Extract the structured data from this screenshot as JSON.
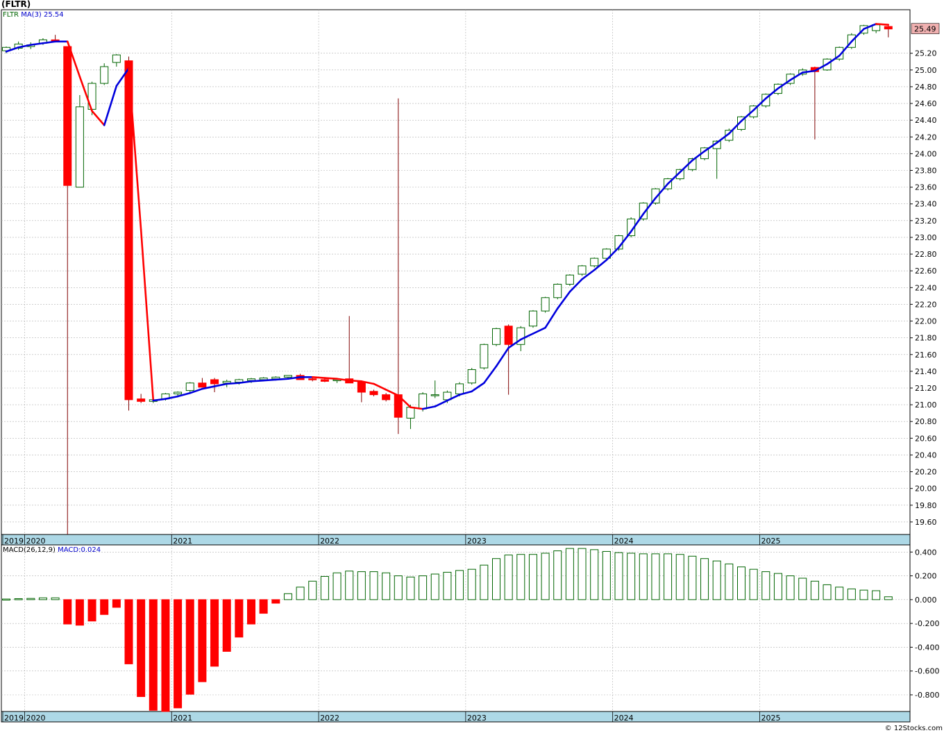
{
  "title": "(FLTR)",
  "legend": {
    "symbol": "FLTR",
    "ma_label": "MA(3)",
    "ma_value": "25.54"
  },
  "macd_legend": {
    "label": "MACD(26,12,9)",
    "value_label": "MACD:0.024"
  },
  "last_price_label": "25.49",
  "watermark": "© 12Stocks.com",
  "colors": {
    "up_candle": "#006400",
    "down_candle": "#ff0000",
    "ma_up": "#0000dd",
    "ma_down": "#ff0000",
    "grid": "#b0b0b0",
    "axis_band": "#add8e6",
    "price_badge": "#f0b0b0"
  },
  "chart_data": [
    {
      "type": "candlestick",
      "interval": "monthly",
      "ylim": [
        19.45,
        25.72
      ],
      "y_ticks": [
        "19.60",
        "19.80",
        "20.00",
        "20.20",
        "20.40",
        "20.60",
        "20.80",
        "21.00",
        "21.20",
        "21.40",
        "21.60",
        "21.80",
        "22.00",
        "22.20",
        "22.40",
        "22.60",
        "22.80",
        "23.00",
        "23.20",
        "23.40",
        "23.60",
        "23.80",
        "24.00",
        "24.20",
        "24.40",
        "24.60",
        "24.80",
        "25.00",
        "25.20"
      ],
      "x_tick_labels": [
        "2019",
        "2020",
        "2021",
        "2022",
        "2023",
        "2024",
        "2025"
      ],
      "first_period": "2019-11",
      "ma_label": "MA(3)",
      "candles": [
        [
          25.23,
          25.28,
          25.2,
          25.27
        ],
        [
          25.26,
          25.34,
          25.24,
          25.31
        ],
        [
          25.28,
          25.33,
          25.25,
          25.3
        ],
        [
          25.32,
          25.38,
          25.3,
          25.36
        ],
        [
          25.36,
          25.42,
          25.33,
          25.34
        ],
        [
          25.28,
          25.28,
          19.45,
          23.62
        ],
        [
          23.6,
          24.7,
          23.6,
          24.56
        ],
        [
          24.53,
          24.86,
          24.46,
          24.84
        ],
        [
          24.84,
          25.08,
          24.82,
          25.04
        ],
        [
          25.09,
          25.19,
          25.04,
          25.18
        ],
        [
          25.11,
          25.16,
          20.93,
          21.06
        ],
        [
          21.07,
          21.13,
          21.02,
          21.04
        ],
        [
          21.04,
          21.08,
          21.02,
          21.06
        ],
        [
          21.07,
          21.14,
          21.05,
          21.13
        ],
        [
          21.13,
          21.16,
          21.1,
          21.15
        ],
        [
          21.17,
          21.27,
          21.15,
          21.26
        ],
        [
          21.26,
          21.32,
          21.23,
          21.21
        ],
        [
          21.3,
          21.32,
          21.15,
          21.25
        ],
        [
          21.26,
          21.3,
          21.21,
          21.28
        ],
        [
          21.27,
          21.31,
          21.24,
          21.3
        ],
        [
          21.29,
          21.32,
          21.26,
          21.31
        ],
        [
          21.3,
          21.33,
          21.28,
          21.32
        ],
        [
          21.31,
          21.34,
          21.29,
          21.33
        ],
        [
          21.33,
          21.35,
          21.31,
          21.35
        ],
        [
          21.35,
          21.37,
          21.32,
          21.3
        ],
        [
          21.31,
          21.33,
          21.28,
          21.3
        ],
        [
          21.3,
          21.31,
          21.27,
          21.28
        ],
        [
          21.29,
          21.32,
          21.26,
          21.3
        ],
        [
          21.31,
          22.06,
          21.26,
          21.26
        ],
        [
          21.27,
          21.29,
          21.03,
          21.15
        ],
        [
          21.16,
          21.18,
          21.1,
          21.12
        ],
        [
          21.12,
          21.14,
          21.04,
          21.06
        ],
        [
          21.12,
          24.66,
          20.65,
          20.85
        ],
        [
          20.84,
          21.0,
          20.71,
          20.97
        ],
        [
          20.95,
          21.15,
          20.92,
          21.13
        ],
        [
          21.11,
          21.29,
          21.08,
          21.12
        ],
        [
          21.06,
          21.17,
          21.02,
          21.15
        ],
        [
          21.13,
          21.27,
          21.1,
          21.25
        ],
        [
          21.26,
          21.44,
          21.24,
          21.42
        ],
        [
          21.44,
          21.73,
          21.42,
          21.72
        ],
        [
          21.72,
          21.92,
          21.7,
          21.91
        ],
        [
          21.94,
          21.96,
          21.12,
          21.72
        ],
        [
          21.72,
          21.94,
          21.64,
          21.92
        ],
        [
          21.94,
          22.13,
          21.92,
          22.12
        ],
        [
          22.12,
          22.29,
          22.1,
          22.28
        ],
        [
          22.28,
          22.45,
          22.26,
          22.44
        ],
        [
          22.44,
          22.56,
          22.42,
          22.55
        ],
        [
          22.56,
          22.67,
          22.54,
          22.66
        ],
        [
          22.66,
          22.76,
          22.64,
          22.75
        ],
        [
          22.75,
          22.87,
          22.73,
          22.86
        ],
        [
          22.86,
          23.03,
          22.84,
          23.02
        ],
        [
          23.02,
          23.24,
          23.0,
          23.22
        ],
        [
          23.22,
          23.42,
          23.2,
          23.41
        ],
        [
          23.41,
          23.59,
          23.39,
          23.58
        ],
        [
          23.58,
          23.71,
          23.56,
          23.7
        ],
        [
          23.7,
          23.82,
          23.68,
          23.81
        ],
        [
          23.81,
          23.95,
          23.79,
          23.94
        ],
        [
          23.94,
          24.08,
          23.92,
          24.07
        ],
        [
          24.06,
          24.16,
          23.7,
          24.15
        ],
        [
          24.16,
          24.3,
          24.14,
          24.28
        ],
        [
          24.29,
          24.45,
          24.27,
          24.44
        ],
        [
          24.44,
          24.58,
          24.42,
          24.57
        ],
        [
          24.57,
          24.72,
          24.55,
          24.71
        ],
        [
          24.72,
          24.84,
          24.7,
          24.83
        ],
        [
          24.84,
          24.96,
          24.82,
          24.95
        ],
        [
          24.95,
          25.02,
          24.93,
          25.0
        ],
        [
          25.03,
          25.04,
          24.17,
          24.98
        ],
        [
          25.0,
          25.14,
          24.99,
          25.13
        ],
        [
          25.13,
          25.28,
          25.11,
          25.27
        ],
        [
          25.27,
          25.44,
          25.25,
          25.42
        ],
        [
          25.44,
          25.54,
          25.42,
          25.53
        ],
        [
          25.47,
          25.55,
          25.44,
          25.54
        ],
        [
          25.52,
          25.53,
          25.39,
          25.49
        ]
      ],
      "ma": [
        25.22,
        25.27,
        25.3,
        25.32,
        25.34,
        25.34,
        24.92,
        24.51,
        24.34,
        24.81,
        25.02,
        23.09,
        21.05,
        21.07,
        21.1,
        21.14,
        21.19,
        21.22,
        21.25,
        21.26,
        21.28,
        21.29,
        21.3,
        21.31,
        21.33,
        21.33,
        21.32,
        21.31,
        21.29,
        21.28,
        21.25,
        21.18,
        21.11,
        20.97,
        20.95,
        20.98,
        21.05,
        21.12,
        21.16,
        21.26,
        21.46,
        21.68,
        21.78,
        21.85,
        21.92,
        22.15,
        22.35,
        22.5,
        22.61,
        22.73,
        22.88,
        23.07,
        23.28,
        23.47,
        23.64,
        23.78,
        23.92,
        24.03,
        24.13,
        24.24,
        24.39,
        24.52,
        24.66,
        24.78,
        24.88,
        24.97,
        24.99,
        25.07,
        25.17,
        25.34,
        25.49,
        25.55,
        25.54
      ]
    },
    {
      "type": "bar",
      "name": "MACD(26,12,9)",
      "ylim": [
        -0.94,
        0.46
      ],
      "y_ticks": [
        "0.400",
        "0.200",
        "0.000",
        "-0.200",
        "-0.400",
        "-0.600",
        "-0.800"
      ],
      "x_tick_labels": [
        "2019",
        "2020",
        "2021",
        "2022",
        "2023",
        "2024",
        "2025"
      ],
      "values": [
        0.005,
        0.008,
        0.01,
        0.015,
        0.015,
        -0.205,
        -0.215,
        -0.18,
        -0.125,
        -0.065,
        -0.54,
        -0.815,
        -0.93,
        -0.94,
        -0.91,
        -0.795,
        -0.69,
        -0.56,
        -0.435,
        -0.315,
        -0.205,
        -0.115,
        -0.03,
        0.05,
        0.105,
        0.155,
        0.195,
        0.225,
        0.24,
        0.235,
        0.235,
        0.225,
        0.2,
        0.19,
        0.2,
        0.215,
        0.23,
        0.245,
        0.255,
        0.29,
        0.345,
        0.375,
        0.38,
        0.38,
        0.39,
        0.41,
        0.43,
        0.43,
        0.42,
        0.405,
        0.395,
        0.39,
        0.385,
        0.385,
        0.385,
        0.38,
        0.365,
        0.345,
        0.325,
        0.3,
        0.275,
        0.255,
        0.235,
        0.22,
        0.2,
        0.18,
        0.155,
        0.125,
        0.105,
        0.09,
        0.08,
        0.075,
        0.024
      ]
    }
  ]
}
